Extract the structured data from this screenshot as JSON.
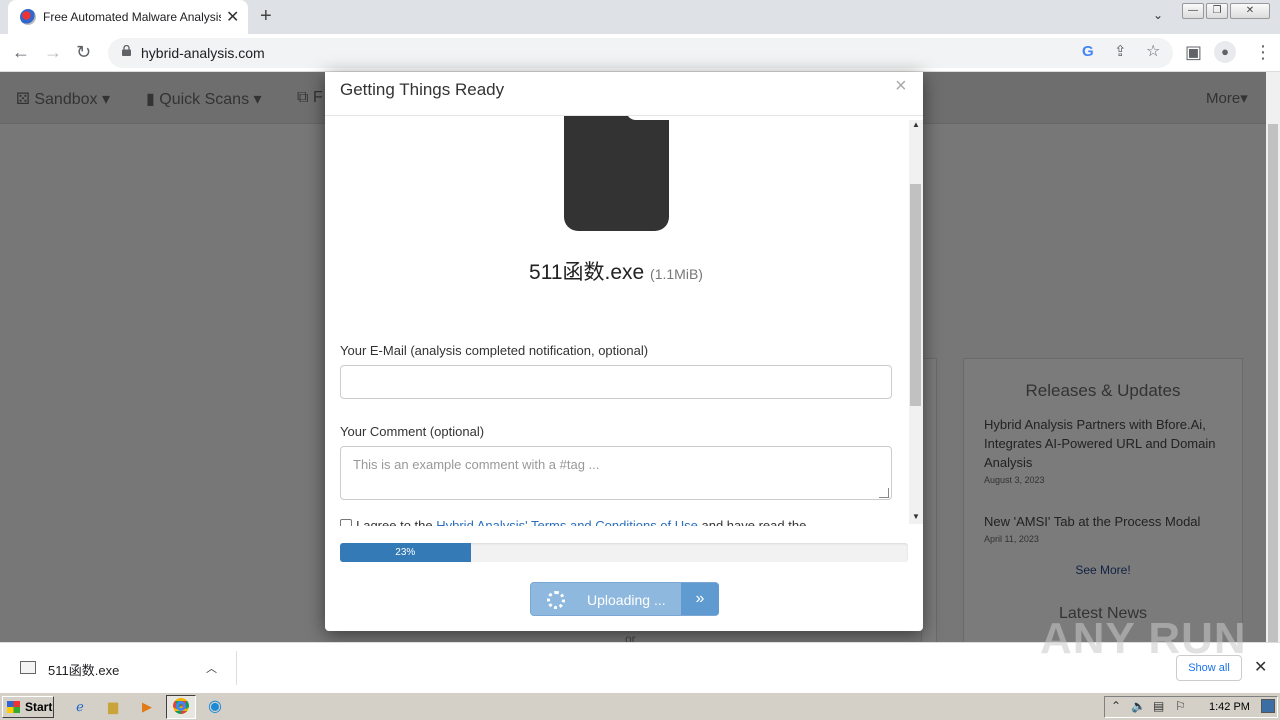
{
  "browser": {
    "tab_title": "Free Automated Malware Analysis S",
    "tab_close": "✕",
    "new_tab": "+",
    "url": "hybrid-analysis.com",
    "google_icon": "G"
  },
  "nav": {
    "sandbox": "Sandbox",
    "quick_scans": "Quick Scans",
    "file": "F",
    "more": "More"
  },
  "releases": {
    "heading": "Releases & Updates",
    "news1_title": "Hybrid Analysis Partners with Bfore.Ai, Integrates AI-Powered URL and Domain Analysis",
    "news1_date": "August 3, 2023",
    "news2_title": "New 'AMSI' Tab at the Process Modal",
    "news2_date": "April 11, 2023",
    "see_more": "See More!",
    "latest_news": "Latest News"
  },
  "or_text": "or",
  "modal": {
    "title": "Getting Things Ready",
    "close": "×",
    "file_name": "511函数.exe",
    "file_size": "(1.1MiB)",
    "email_label": "Your E-Mail (analysis completed notification, optional)",
    "email_value": "",
    "comment_label": "Your Comment (optional)",
    "comment_placeholder": "This is an example comment with a #tag ...",
    "agree_prefix": "I agree to the ",
    "agree_link": "Hybrid Analysis' Terms and Conditions of Use",
    "agree_suffix": " and have read the",
    "progress_label": "23%",
    "progress_value": 23,
    "upload_label": "Uploading ...",
    "upload_arrow": "»"
  },
  "downloads": {
    "file_name": "511函数.exe",
    "show_all": "Show all",
    "close": "✕"
  },
  "watermark": "ANY RUN",
  "taskbar": {
    "start": "Start",
    "clock": "1:42 PM"
  },
  "colors": {
    "accent": "#337ab7",
    "link": "#2a6ebb"
  }
}
